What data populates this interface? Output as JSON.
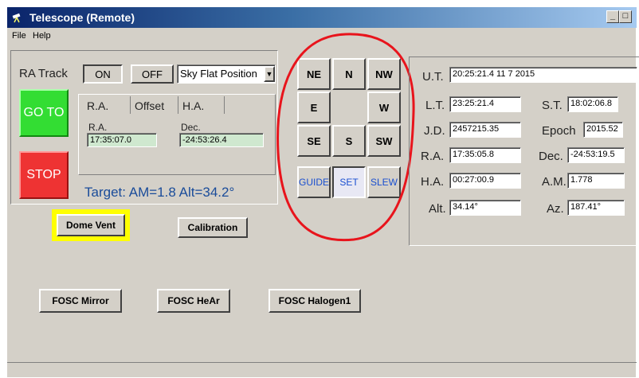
{
  "window": {
    "title": "Telescope (Remote)"
  },
  "titlebar_buttons": {
    "minimize": "_",
    "maximize": "□"
  },
  "menu": {
    "items": [
      "File",
      "Help"
    ]
  },
  "tracking": {
    "label": "RA Track",
    "on_label": "ON",
    "off_label": "OFF",
    "position_select": "Sky Flat Position"
  },
  "actions": {
    "goto_label": "GO TO",
    "stop_label": "STOP"
  },
  "coord_tabs": [
    "R.A.",
    "Offset",
    "H.A."
  ],
  "coords": {
    "ra_label": "R.A.",
    "ra_value": "17:35:07.0",
    "dec_label": "Dec.",
    "dec_value": "-24:53:26.4"
  },
  "target": {
    "text": "Target:  AM=1.8  Alt=34.2°"
  },
  "directions": {
    "ne": "NE",
    "n": "N",
    "nw": "NW",
    "e": "E",
    "w": "W",
    "se": "SE",
    "s": "S",
    "sw": "SW"
  },
  "modes": {
    "guide": "GUIDE",
    "set": "SET",
    "slew": "SLEW"
  },
  "info": {
    "ut_label": "U.T.",
    "ut_value": "20:25:21.4        11  7 2015",
    "lt_label": "L.T.",
    "lt_value": "23:25:21.4",
    "st_label": "S.T.",
    "st_value": "18:02:06.8",
    "jd_label": "J.D.",
    "jd_value": "2457215.35",
    "epoch_label": "Epoch",
    "epoch_value": "2015.52",
    "ra_label": "R.A.",
    "ra_value": "17:35:05.8",
    "dec_label": "Dec.",
    "dec_value": "-24:53:19.5",
    "ha_label": "H.A.",
    "ha_value": "00:27:00.9",
    "am_label": "A.M.",
    "am_value": "1.778",
    "alt_label": "Alt.",
    "alt_value": "34.14°",
    "az_label": "Az.",
    "az_value": "187.41°"
  },
  "lamps": {
    "dome_vent": "Dome Vent",
    "calibration": "Calibration",
    "fosc_mirror": "FOSC Mirror",
    "fosc_hear": "FOSC HeAr",
    "fosc_halogen": "FOSC Halogen1"
  },
  "colors": {
    "goto_green": "#33dd33",
    "stop_red": "#ee3333",
    "highlight_yellow": "#ffff00",
    "annotation_red": "#e8141c",
    "field_green": "#cfe8cf"
  }
}
